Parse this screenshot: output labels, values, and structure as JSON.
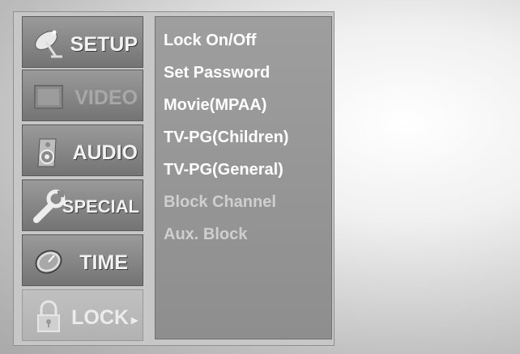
{
  "tabs": [
    {
      "label": "SETUP",
      "icon": "satellite-dish-icon"
    },
    {
      "label": "VIDEO",
      "icon": "screen-icon"
    },
    {
      "label": "AUDIO",
      "icon": "speaker-icon"
    },
    {
      "label": "SPECIAL",
      "icon": "wrench-icon"
    },
    {
      "label": "TIME",
      "icon": "clock-icon"
    },
    {
      "label": "LOCK",
      "icon": "padlock-icon",
      "arrow": "▸"
    }
  ],
  "menu": {
    "items": [
      "Lock On/Off",
      "Set Password",
      "Movie(MPAA)",
      "TV-PG(Children)",
      "TV-PG(General)",
      "Block Channel",
      "Aux. Block"
    ]
  }
}
